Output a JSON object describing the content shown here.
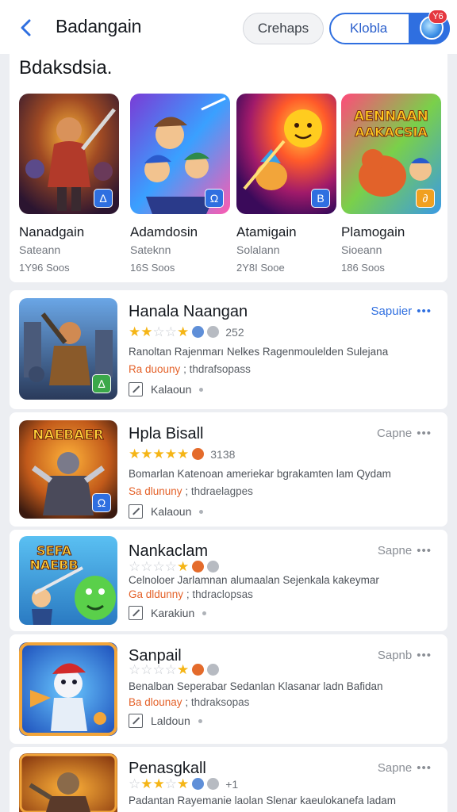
{
  "header": {
    "title": "Badangain",
    "back_icon": "chevron-left-icon",
    "pill_grey_label": "Crehaps",
    "pill_blue_label": "Klobla",
    "badge": "Y6"
  },
  "featured": {
    "title": "Bdaksdsia.",
    "items": [
      {
        "name": "Nanadgain",
        "sub": "Sateann",
        "meta": "1Y96 Soos",
        "badge": "Δ"
      },
      {
        "name": "Adamdosin",
        "sub": "Sateknn",
        "meta": "16S Soos",
        "badge": "Ω"
      },
      {
        "name": "Atamigain",
        "sub": "Solalann",
        "meta": "2Y8Ι Sooe",
        "badge": "B"
      },
      {
        "name": "Plamogain",
        "sub": "Sioeann",
        "meta": "186 Soos",
        "badge": "∂"
      }
    ],
    "banner_text": [
      "AENNAAN",
      "AAKACSIA"
    ]
  },
  "list": [
    {
      "title": "Hanala Naangan",
      "action": "Sapuier",
      "action_style": "blue",
      "stars_on": 2,
      "rating_count": "252",
      "desc": "Ranoltan Rajenmarı Nelkes Ragenmoulelden Sulejana",
      "tag_a": "Ra duouny",
      "tag_b": "thdrafsopass",
      "note": "Kalaoun",
      "thumb_badge": "∆"
    },
    {
      "title": "Hpla Bisall",
      "action": "Capne",
      "action_style": "grey",
      "stars_on": 5,
      "rating_count": "3138",
      "desc": "Bomarlan Katenoan ameriekar bgrakamten lam Qydam",
      "tag_a": "Sa dlununy",
      "tag_b": "thdraelagpes",
      "note": "Kalaoun",
      "thumb_badge": "Ω",
      "banner": "NAEBAER"
    },
    {
      "title": "Nankaclam",
      "action": "Sapne",
      "action_style": "grey",
      "stars_on": 1,
      "rating_count": "",
      "desc": "Celnoloer Jarlamnan alumaalan Sejenkala kakeymar",
      "tag_a": "Ga dldunny",
      "tag_b": "thdraclopsas",
      "note": "Karakiun",
      "banner": [
        "SEFA",
        "NAEBB"
      ]
    },
    {
      "title": "Sanpail",
      "action": "Sapnb",
      "action_style": "grey",
      "stars_on": 1,
      "rating_count": "",
      "desc": "Benalban Seperabar Sedanlan Klasanar ladn Bafidan",
      "tag_a": "Ba dlounay",
      "tag_b": "thdraksopas",
      "note": "Laldoun"
    },
    {
      "title": "Penasgkall",
      "action": "Sapne",
      "action_style": "grey",
      "stars_on": 3,
      "rating_count": "+1",
      "desc": "Padantan Rayemanie laolan Slenar kaeulokanefa ladam"
    }
  ],
  "colors": {
    "accent": "#2f6fe0",
    "star": "#f5b516",
    "tag_orange": "#e4622a",
    "background": "#eceef2"
  }
}
